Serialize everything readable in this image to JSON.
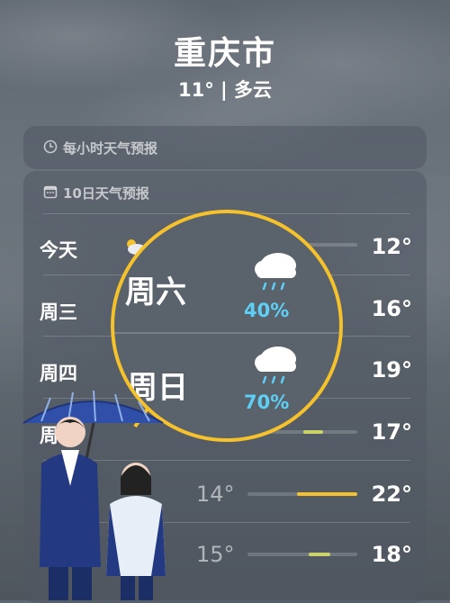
{
  "header": {
    "city": "重庆市",
    "condition": "11° | 多云"
  },
  "hourly": {
    "label": "每小时天气预报"
  },
  "ten_day": {
    "label": "10日天气预报",
    "rows": [
      {
        "day": "今天",
        "low": "",
        "high": "12°"
      },
      {
        "day": "周三",
        "low": "",
        "high": "16°"
      },
      {
        "day": "周四",
        "low": "",
        "high": "19°"
      },
      {
        "day": "周",
        "low": "",
        "high": "17°"
      },
      {
        "day": "",
        "low": "14°",
        "high": "22°"
      },
      {
        "day": "",
        "low": "15°",
        "high": "18°"
      }
    ]
  },
  "magnifier": {
    "items": [
      {
        "day": "周六",
        "icon": "rain-cloud-icon",
        "pct": "40%"
      },
      {
        "day": "周日",
        "icon": "rain-cloud-icon",
        "pct": "70%"
      }
    ]
  },
  "colors": {
    "ring": "#f5c22b",
    "precip": "#5fd0f5",
    "bar_warm": "#f5c22b",
    "bar_cool": "#c9d36a"
  }
}
